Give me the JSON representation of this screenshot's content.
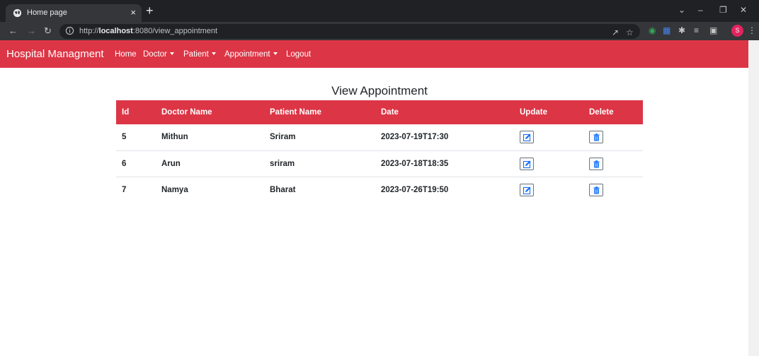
{
  "browser": {
    "tab_title": "Home page",
    "tab_close": "×",
    "new_tab": "+",
    "url_prefix": "http://",
    "url_host": "localhost",
    "url_rest": ":8080/view_appointment",
    "profile_initial": "S"
  },
  "navbar": {
    "brand": "Hospital Managment",
    "links": [
      {
        "label": "Home",
        "dropdown": false
      },
      {
        "label": "Doctor",
        "dropdown": true
      },
      {
        "label": "Patient",
        "dropdown": true
      },
      {
        "label": "Appointment",
        "dropdown": true
      },
      {
        "label": "Logout",
        "dropdown": false
      }
    ]
  },
  "page": {
    "title": "View Appointment"
  },
  "table": {
    "headers": [
      "Id",
      "Doctor Name",
      "Patient Name",
      "Date",
      "Update",
      "Delete"
    ],
    "rows": [
      {
        "id": "5",
        "doctor": "Mithun",
        "patient": "Sriram",
        "date": "2023-07-19T17:30"
      },
      {
        "id": "6",
        "doctor": "Arun",
        "patient": "sriram",
        "date": "2023-07-18T18:35"
      },
      {
        "id": "7",
        "doctor": "Namya",
        "patient": "Bharat",
        "date": "2023-07-26T19:50"
      }
    ],
    "update_icon": "edit-icon",
    "delete_icon": "trash-icon"
  },
  "colors": {
    "brand": "#dc3545",
    "icon_blue": "#0d6efd"
  }
}
